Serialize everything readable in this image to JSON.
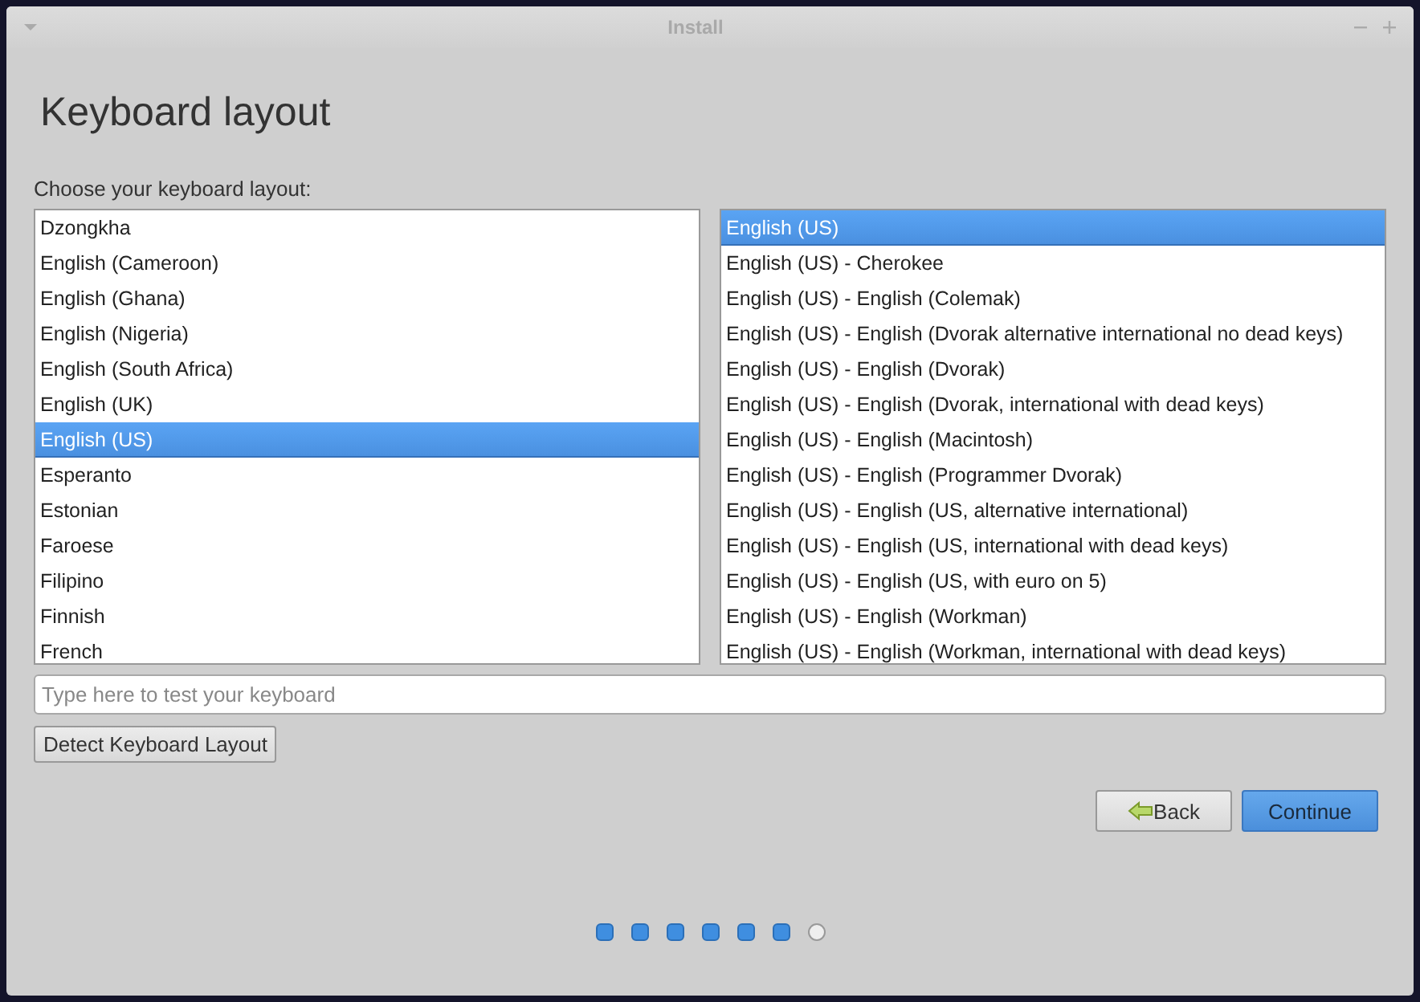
{
  "window": {
    "title": "Install"
  },
  "heading": "Keyboard layout",
  "prompt": "Choose your keyboard layout:",
  "languages": [
    {
      "label": "Dzongkha",
      "selected": false
    },
    {
      "label": "English (Cameroon)",
      "selected": false
    },
    {
      "label": "English (Ghana)",
      "selected": false
    },
    {
      "label": "English (Nigeria)",
      "selected": false
    },
    {
      "label": "English (South Africa)",
      "selected": false
    },
    {
      "label": "English (UK)",
      "selected": false
    },
    {
      "label": "English (US)",
      "selected": true
    },
    {
      "label": "Esperanto",
      "selected": false
    },
    {
      "label": "Estonian",
      "selected": false
    },
    {
      "label": "Faroese",
      "selected": false
    },
    {
      "label": "Filipino",
      "selected": false
    },
    {
      "label": "Finnish",
      "selected": false
    },
    {
      "label": "French",
      "selected": false
    }
  ],
  "variants": [
    {
      "label": "English (US)",
      "selected": true
    },
    {
      "label": "English (US) - Cherokee",
      "selected": false
    },
    {
      "label": "English (US) - English (Colemak)",
      "selected": false
    },
    {
      "label": "English (US) - English (Dvorak alternative international no dead keys)",
      "selected": false
    },
    {
      "label": "English (US) - English (Dvorak)",
      "selected": false
    },
    {
      "label": "English (US) - English (Dvorak, international with dead keys)",
      "selected": false
    },
    {
      "label": "English (US) - English (Macintosh)",
      "selected": false
    },
    {
      "label": "English (US) - English (Programmer Dvorak)",
      "selected": false
    },
    {
      "label": "English (US) - English (US, alternative international)",
      "selected": false
    },
    {
      "label": "English (US) - English (US, international with dead keys)",
      "selected": false
    },
    {
      "label": "English (US) - English (US, with euro on 5)",
      "selected": false
    },
    {
      "label": "English (US) - English (Workman)",
      "selected": false
    },
    {
      "label": "English (US) - English (Workman, international with dead keys)",
      "selected": false
    }
  ],
  "test_field": {
    "placeholder": "Type here to test your keyboard"
  },
  "detect_button": "Detect Keyboard Layout",
  "buttons": {
    "back": "Back",
    "continue": "Continue"
  },
  "steps": [
    {
      "done": true
    },
    {
      "done": true
    },
    {
      "done": true
    },
    {
      "done": true
    },
    {
      "done": true
    },
    {
      "done": true
    },
    {
      "done": false
    }
  ]
}
